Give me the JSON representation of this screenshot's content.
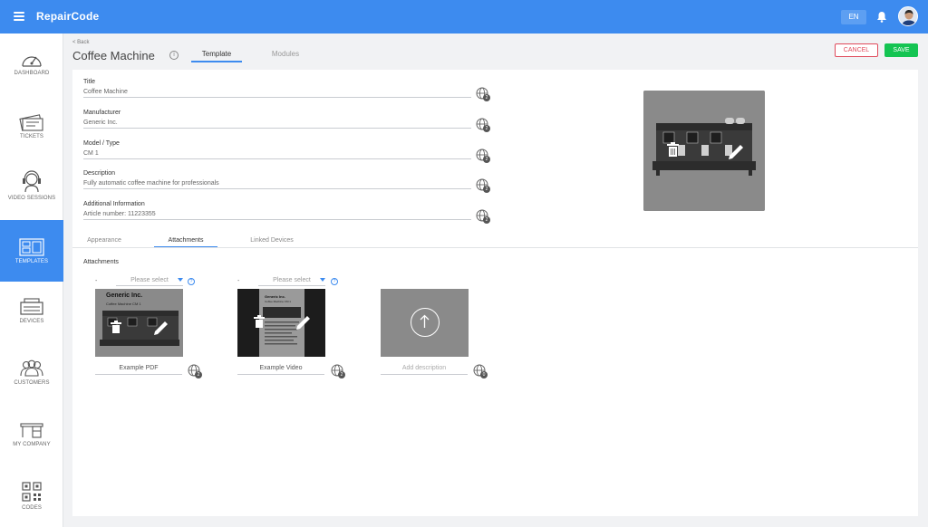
{
  "app": {
    "brand": "RepairCode",
    "language": "EN"
  },
  "sidebar": {
    "items": [
      {
        "label": "DASHBOARD",
        "icon": "dashboard-gauge-icon"
      },
      {
        "label": "TICKETS",
        "icon": "tickets-icon"
      },
      {
        "label": "VIDEO SESSIONS",
        "icon": "headset-icon"
      },
      {
        "label": "TEMPLATES",
        "icon": "templates-icon",
        "active": true
      },
      {
        "label": "DEVICES",
        "icon": "devices-icon"
      },
      {
        "label": "CUSTOMERS",
        "icon": "customers-icon"
      },
      {
        "label": "MY COMPANY",
        "icon": "company-desk-icon"
      },
      {
        "label": "CODES",
        "icon": "qr-code-icon"
      }
    ]
  },
  "header": {
    "back": "< Back",
    "title": "Coffee Machine",
    "tabs": [
      {
        "label": "Template",
        "active": true
      },
      {
        "label": "Modules",
        "active": false
      }
    ],
    "cancel": "CANCEL",
    "save": "SAVE"
  },
  "form": {
    "fields": [
      {
        "label": "Title",
        "value": "Coffee Machine",
        "badge": "2"
      },
      {
        "label": "Manufacturer",
        "value": "Generic Inc.",
        "badge": "2"
      },
      {
        "label": "Model / Type",
        "value": "CM 1",
        "badge": "2"
      },
      {
        "label": "Description",
        "value": "Fully automatic coffee machine for professionals",
        "badge": "2"
      },
      {
        "label": "Additional Information",
        "value": "Article number: 11223355",
        "badge": "2"
      }
    ]
  },
  "subtabs": [
    {
      "label": "Appearance",
      "active": false
    },
    {
      "label": "Attachments",
      "active": true
    },
    {
      "label": "Linked Devices",
      "active": false
    }
  ],
  "attachments": {
    "section_label": "Attachments",
    "items": [
      {
        "dash": "-",
        "select_placeholder": "Please select",
        "help": "?",
        "description": "Example PDF",
        "badge": "2",
        "preview_title": "Generic Inc.",
        "preview_subtitle": "Coffee Machine CM 1"
      },
      {
        "dash": "-",
        "select_placeholder": "Please select",
        "help": "?",
        "description": "Example Video",
        "badge": "2",
        "preview_title": "Generic Inc.",
        "preview_subtitle": "Coffee Machine CM 1"
      }
    ],
    "upload": {
      "placeholder": "Add description",
      "badge": "0"
    }
  },
  "colors": {
    "accent": "#3d8bef",
    "cancel": "#e04a5b",
    "save": "#14c452"
  }
}
